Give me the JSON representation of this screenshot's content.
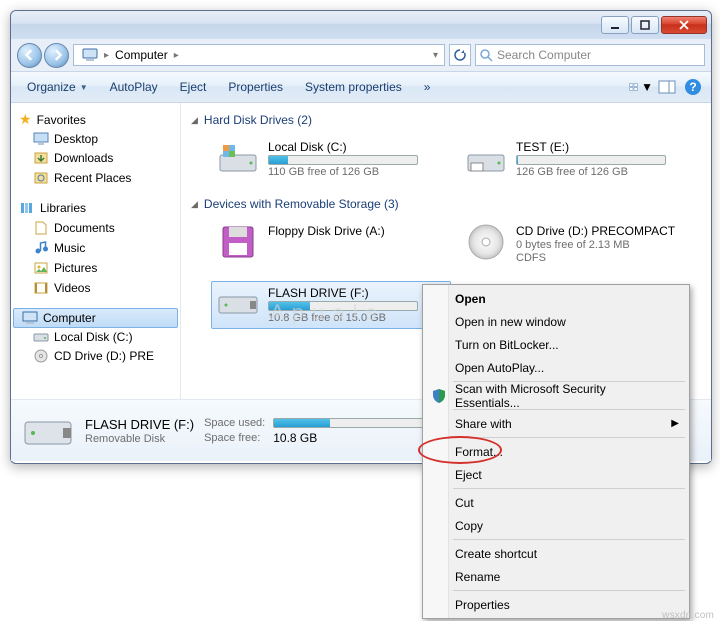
{
  "titlebar": {
    "tooltip_min": "Minimize",
    "tooltip_max": "Maximize",
    "tooltip_close": "Close"
  },
  "address": {
    "location": "Computer"
  },
  "search": {
    "placeholder": "Search Computer"
  },
  "toolbar": {
    "organize": "Organize",
    "autoplay": "AutoPlay",
    "eject": "Eject",
    "properties": "Properties",
    "system_properties": "System properties",
    "more": "»"
  },
  "nav": {
    "favorites": "Favorites",
    "desktop": "Desktop",
    "downloads": "Downloads",
    "recent": "Recent Places",
    "libraries": "Libraries",
    "documents": "Documents",
    "music": "Music",
    "pictures": "Pictures",
    "videos": "Videos",
    "computer": "Computer",
    "local_c": "Local Disk (C:)",
    "cd_d": "CD Drive (D:) PRE"
  },
  "sections": {
    "hdd": "Hard Disk Drives (2)",
    "removable": "Devices with Removable Storage (3)"
  },
  "drives": {
    "c": {
      "label": "Local Disk (C:)",
      "free": "110 GB free of 126 GB",
      "fill_pct": 13
    },
    "e": {
      "label": "TEST (E:)",
      "free": "126 GB free of 126 GB",
      "fill_pct": 1
    },
    "a": {
      "label": "Floppy Disk Drive (A:)"
    },
    "d": {
      "label": "CD Drive (D:) PRECOMPACT",
      "free": "0 bytes free of 2.13 MB",
      "fs": "CDFS"
    },
    "f": {
      "label": "FLASH DRIVE (F:)",
      "free": "10.8 GB free of 15.0 GB",
      "fill_pct": 28
    }
  },
  "details": {
    "name": "FLASH DRIVE (F:)",
    "type": "Removable Disk",
    "space_used_label": "Space used:",
    "space_free_label": "Space free:",
    "space_free_value": "10.8 GB"
  },
  "context": {
    "open": "Open",
    "open_new": "Open in new window",
    "bitlocker": "Turn on BitLocker...",
    "autoplay": "Open AutoPlay...",
    "scan": "Scan with Microsoft Security Essentials...",
    "share": "Share with",
    "format": "Format...",
    "eject": "Eject",
    "cut": "Cut",
    "copy": "Copy",
    "shortcut": "Create shortcut",
    "rename": "Rename",
    "properties": "Properties"
  },
  "watermark": {
    "site": "wsxdn.com",
    "appuals": "A  p  u  a  l  s"
  }
}
